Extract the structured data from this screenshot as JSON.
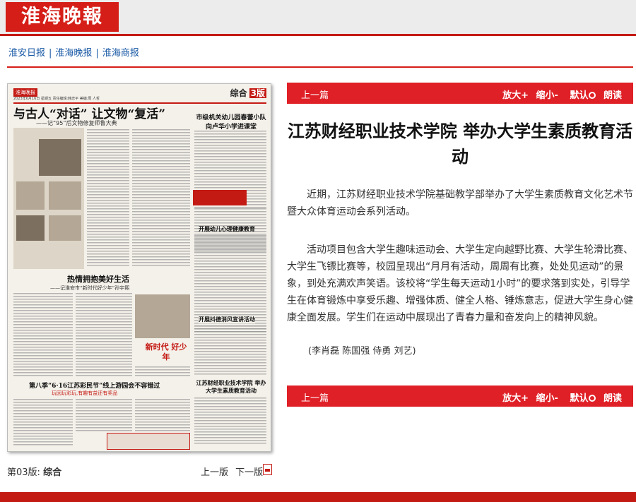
{
  "header": {
    "logo_text": "淮海晚報"
  },
  "nav": {
    "links": [
      "淮安日报",
      "淮海晚报",
      "淮海商报"
    ]
  },
  "newspaper": {
    "tag": "淮海晚报",
    "date_line": "2023年6月16日 星期五 责任编辑:韩忠平 美编:周 人哲",
    "section": "综合",
    "section_no": "3版",
    "main_title": "与古人“对话” 让文物“复活”",
    "main_subtitle": "——记“95”后文物修复师鲁大典",
    "story2_title": "热情拥抱美好生活",
    "story2_subtitle": "——记淮安市“新时代好少年”孙宇熙",
    "badge_text": "新时代 好少年",
    "story3_title": "第八季“6·16江苏彩民节”线上游园会不容错过",
    "story3_subtitle": "玩因玩彩玩,有趣有益还有奖品",
    "col_title_1": "市级机关幼儿园春蕾小队 向卢华小学进课堂",
    "col_title_2": "开展幼儿心理健康教育",
    "col_title_3": "开展抖德消风宣讲活动",
    "col_title_4": "江苏财经职业技术学院 举办大学生素质教育活动"
  },
  "pager": {
    "label": "第03版:",
    "section": "综合",
    "prev": "上一版",
    "next": "下一版"
  },
  "article": {
    "prev_label": "上一篇",
    "tools": {
      "zoom_in": "放大+",
      "zoom_out": "缩小-",
      "default": "默认",
      "read": "朗读"
    },
    "title": "江苏财经职业技术学院 举办大学生素质教育活动",
    "paragraphs": [
      "近期，江苏财经职业技术学院基础教学部举办了大学生素质教育文化艺术节暨大众体育运动会系列活动。",
      "活动项目包含大学生趣味运动会、大学生定向越野比赛、大学生轮滑比赛、大学生飞镖比赛等，校园呈现出“月月有活动，周周有比赛，处处见运动”的景象，到处充满欢声笑语。该校将“学生每天运动1小时”的要求落到实处，引导学生在体育锻炼中享受乐趣、增强体质、健全人格、锤炼意志，促进大学生身心健康全面发展。学生们在运动中展现出了青春力量和奋发向上的精神风貌。"
    ],
    "authors": "(李肖磊 陈国强 侍勇 刘艺)"
  },
  "colors": {
    "brand_red": "#d51e17",
    "bar_red": "#e02027",
    "nav_blue": "#1a5aa6"
  }
}
